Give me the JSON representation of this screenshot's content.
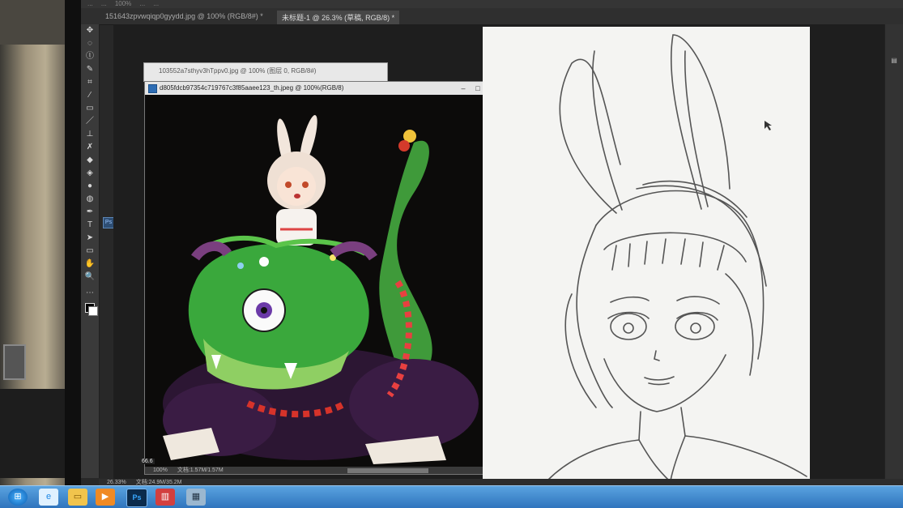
{
  "options_bar": {
    "items": [
      "...",
      "...",
      "100%",
      "...",
      "..."
    ]
  },
  "tabs": [
    {
      "label": "151643zpvwqiqp0gyydd.jpg @ 100% (RGB/8#) *"
    },
    {
      "label": "未标题-1 @ 26.3% (草稿, RGB/8) *"
    }
  ],
  "back_window": {
    "title": "103552a7sthyv3hTppv0.jpg @ 100% (图层 0, RGB/8#)"
  },
  "front_window": {
    "title": "d805fdcb97354c719767c3f85aaee123_th.jpeg @ 100%(RGB/8)",
    "status_zoom": "100%",
    "status_doc": "文档:1.57M/1.57M",
    "side_zoom": "66.6"
  },
  "statusbar": {
    "zoom": "26.33%",
    "doc": "文档:24.9M/35.2M"
  },
  "toolbar": {
    "tools": [
      "move",
      "marquee",
      "lasso",
      "quick-select",
      "crop",
      "eyedropper",
      "healing",
      "brush",
      "clone",
      "history",
      "eraser",
      "gradient",
      "blur",
      "dodge",
      "pen",
      "type",
      "path-select",
      "shape",
      "hand",
      "zoom"
    ]
  },
  "taskbar": {
    "items": [
      "start",
      "ie",
      "explorer",
      "media",
      "photoshop",
      "app1",
      "app2"
    ]
  }
}
